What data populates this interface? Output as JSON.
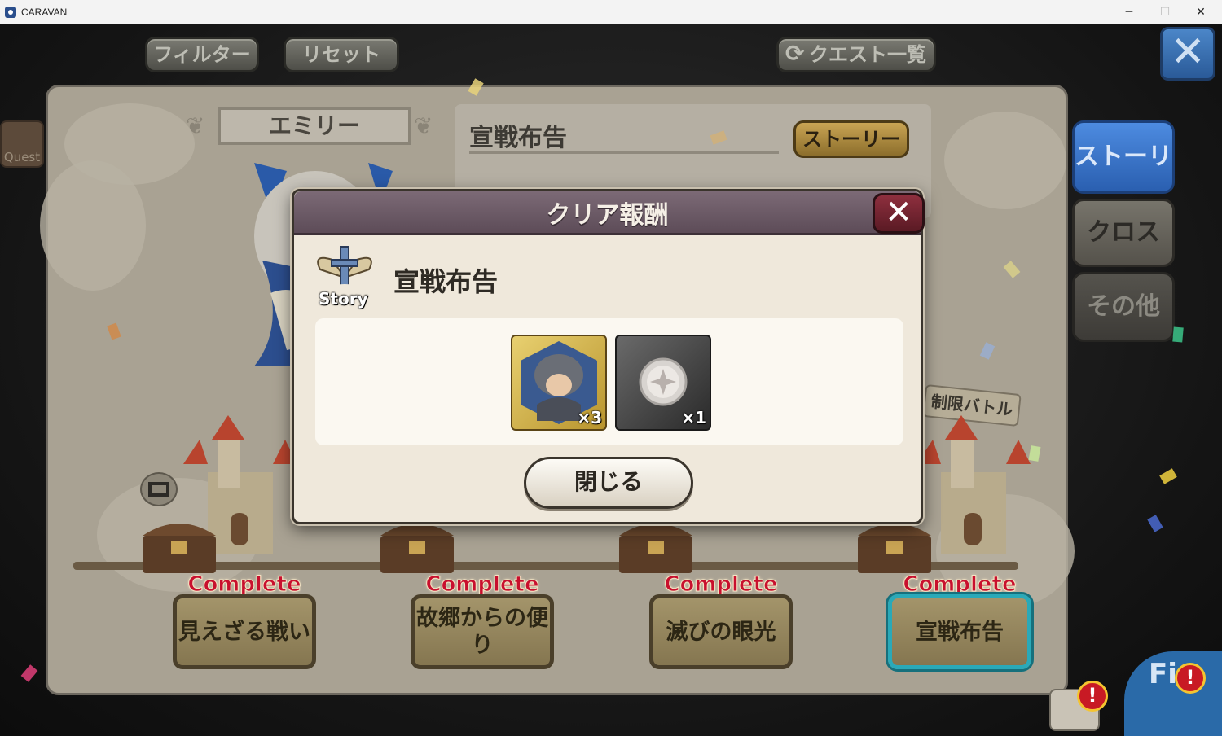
{
  "window": {
    "title": "CARAVAN",
    "minimize_glyph": "─",
    "maximize_glyph": "☐",
    "close_glyph": "✕"
  },
  "toolbar": {
    "filter_label": "フィルター",
    "reset_label": "リセット",
    "quest_list_label": "クエスト一覧"
  },
  "close_glyph": "✕",
  "side_quest_label": "Quest",
  "character": {
    "name": "エミリー"
  },
  "quest_panel": {
    "title": "宣戦布告",
    "story_button": "ストーリー"
  },
  "side_tabs": [
    {
      "label": "ストーリー",
      "active": true
    },
    {
      "label": "クロス",
      "active": false
    },
    {
      "label": "その他",
      "active": false
    }
  ],
  "limit_battle_label": "制限バトル",
  "stages": [
    {
      "status": "Complete",
      "name": "見えざる戦い",
      "selected": false
    },
    {
      "status": "Complete",
      "name": "故郷からの便り",
      "selected": false
    },
    {
      "status": "Complete",
      "name": "滅びの眼光",
      "selected": false
    },
    {
      "status": "Complete",
      "name": "宣戦布告",
      "selected": true
    }
  ],
  "modal": {
    "title": "クリア報酬",
    "story_icon_label": "Story",
    "quest_name": "宣戦布告",
    "rewards": [
      {
        "icon": "armored-hero-portrait-icon",
        "quantity": "×3"
      },
      {
        "icon": "silver-medal-icon",
        "quantity": "×1"
      }
    ],
    "close_button": "閉じる"
  },
  "fi_label": "Fi",
  "alert_glyph": "!",
  "colors": {
    "modal_header": "#6b5a66",
    "close_red": "#7a2534",
    "story_gold": "#b8913e",
    "tab_blue": "#3a7bd5",
    "complete_red": "#c8102e"
  }
}
